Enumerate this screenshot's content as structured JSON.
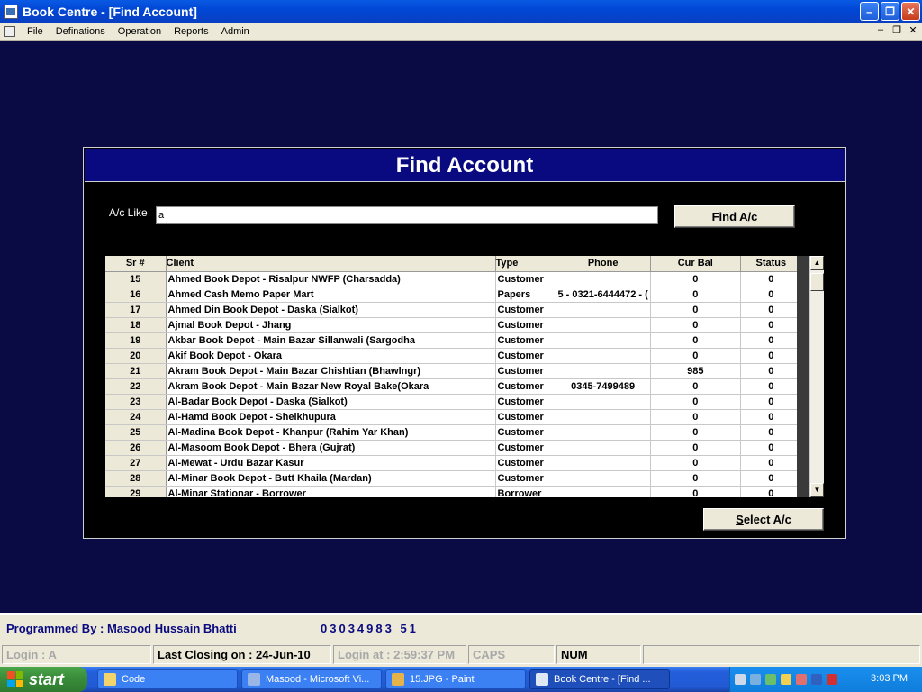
{
  "window": {
    "title": "Book Centre  - [Find Account]",
    "minimize": "–",
    "maximize": "❐",
    "close": "✕"
  },
  "menu": {
    "items": [
      "File",
      "Definations",
      "Operation",
      "Reports",
      "Admin"
    ],
    "mdi_minimize": "–",
    "mdi_restore": "❐",
    "mdi_close": "✕"
  },
  "dialog": {
    "title": "Find Account",
    "search_label": "A/c Like",
    "search_value": "a",
    "find_button": "Find A/c",
    "select_button_prefix": "S",
    "select_button_rest": "elect A/c"
  },
  "grid": {
    "columns": [
      "Sr #",
      "Client",
      "Type",
      "Phone",
      "Cur Bal",
      "Status"
    ],
    "rows": [
      {
        "sr": "15",
        "client": "Ahmed Book Depot - Risalpur NWFP (Charsadda)",
        "type": "Customer",
        "phone": "",
        "bal": "0",
        "status": "0"
      },
      {
        "sr": "16",
        "client": "Ahmed Cash Memo Paper Mart",
        "type": "Papers",
        "phone": "5 - 0321-6444472 - (",
        "bal": "0",
        "status": "0"
      },
      {
        "sr": "17",
        "client": "Ahmed Din Book Depot - Daska (Sialkot)",
        "type": "Customer",
        "phone": "",
        "bal": "0",
        "status": "0"
      },
      {
        "sr": "18",
        "client": "Ajmal Book Depot - Jhang",
        "type": "Customer",
        "phone": "",
        "bal": "0",
        "status": "0"
      },
      {
        "sr": "19",
        "client": "Akbar Book Depot - Main Bazar Sillanwali (Sargodha",
        "type": "Customer",
        "phone": "",
        "bal": "0",
        "status": "0"
      },
      {
        "sr": "20",
        "client": "Akif Book Depot - Okara",
        "type": "Customer",
        "phone": "",
        "bal": "0",
        "status": "0"
      },
      {
        "sr": "21",
        "client": "Akram Book Depot - Main Bazar Chishtian (Bhawlngr)",
        "type": "Customer",
        "phone": "",
        "bal": "985",
        "status": "0"
      },
      {
        "sr": "22",
        "client": "Akram Book Depot - Main Bazar New Royal Bake(Okara",
        "type": "Customer",
        "phone": "0345-7499489",
        "bal": "0",
        "status": "0"
      },
      {
        "sr": "23",
        "client": "Al-Badar Book Depot - Daska (Sialkot)",
        "type": "Customer",
        "phone": "",
        "bal": "0",
        "status": "0"
      },
      {
        "sr": "24",
        "client": "Al-Hamd Book Depot - Sheikhupura",
        "type": "Customer",
        "phone": "",
        "bal": "0",
        "status": "0"
      },
      {
        "sr": "25",
        "client": "Al-Madina Book Depot - Khanpur (Rahim Yar Khan)",
        "type": "Customer",
        "phone": "",
        "bal": "0",
        "status": "0"
      },
      {
        "sr": "26",
        "client": "Al-Masoom Book Depot - Bhera (Gujrat)",
        "type": "Customer",
        "phone": "",
        "bal": "0",
        "status": "0"
      },
      {
        "sr": "27",
        "client": "Al-Mewat - Urdu Bazar Kasur",
        "type": "Customer",
        "phone": "",
        "bal": "0",
        "status": "0"
      },
      {
        "sr": "28",
        "client": "Al-Minar Book Depot - Butt Khaila (Mardan)",
        "type": "Customer",
        "phone": "",
        "bal": "0",
        "status": "0"
      },
      {
        "sr": "29",
        "client": "Al-Minar Stationar - Borrower",
        "type": "Borrower",
        "phone": "",
        "bal": "0",
        "status": "0"
      }
    ]
  },
  "footer": {
    "programmed_by": "Programmed By : Masood Hussain Bhatti",
    "phone": "03034983 51"
  },
  "status": {
    "login": "Login :  A",
    "last_closing": "Last Closing on : 24-Jun-10",
    "login_at": "Login at : 2:59:37 PM",
    "caps": "CAPS",
    "num": "NUM"
  },
  "taskbar": {
    "start": "start",
    "tasks": [
      "Code",
      "Masood - Microsoft Vi...",
      "15.JPG - Paint",
      "Book Centre  - [Find ..."
    ],
    "clock": "3:03 PM"
  },
  "colors": {
    "mdi_background": "#0a0a45",
    "dialog_header": "#0a0a80",
    "footer_text": "#0a0a80"
  }
}
